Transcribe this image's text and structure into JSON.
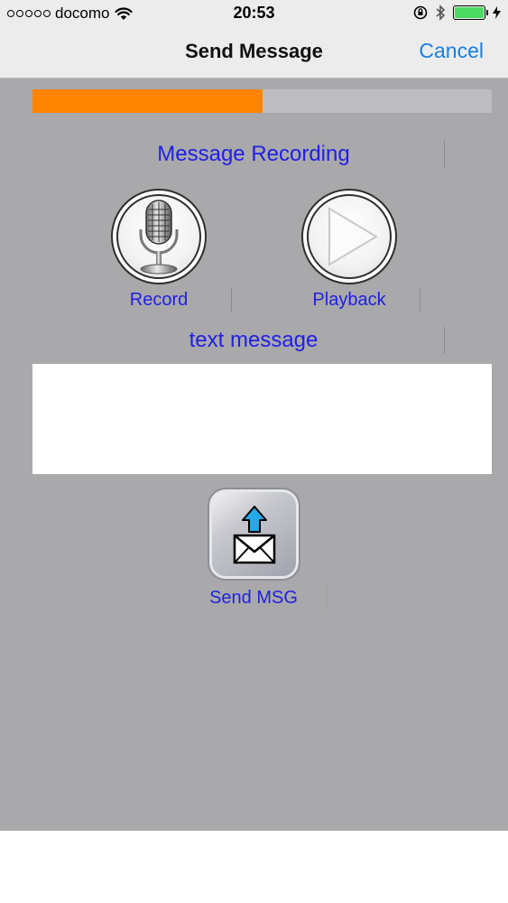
{
  "status_bar": {
    "carrier": "docomo",
    "time": "20:53",
    "icons": [
      "signal-dots-icon",
      "wifi-icon",
      "rotation-lock-icon",
      "bluetooth-icon",
      "battery-icon",
      "charging-icon"
    ]
  },
  "nav": {
    "title": "Send Message",
    "cancel_label": "Cancel"
  },
  "recording": {
    "progress_fraction": 0.5,
    "section_title": "Message Recording",
    "record_label": "Record",
    "playback_label": "Playback"
  },
  "text_section": {
    "title": "text message",
    "value": ""
  },
  "send": {
    "label": "Send MSG"
  },
  "colors": {
    "accent_blue": "#1f1fe6",
    "ios_link": "#1a7fe0",
    "progress_orange": "#ff8400",
    "background_gray": "#a9a9ab",
    "battery_green": "#4cd964"
  }
}
